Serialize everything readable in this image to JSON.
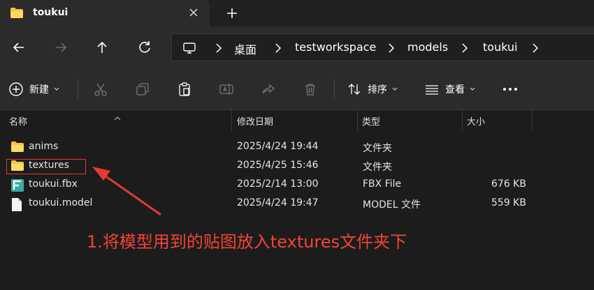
{
  "tab": {
    "title": "toukui",
    "icon": "folder-icon",
    "close_icon": "close-icon",
    "new_tab_icon": "plus-icon"
  },
  "nav": {
    "back_icon": "arrow-left-icon",
    "forward_icon": "arrow-right-icon",
    "up_icon": "arrow-up-icon",
    "refresh_icon": "refresh-icon"
  },
  "breadcrumb": {
    "root_icon": "computer-icon",
    "items": [
      "桌面",
      "testworkspace",
      "models",
      "toukui"
    ]
  },
  "toolbar": {
    "new_label": "新建",
    "sort_label": "排序",
    "view_label": "查看"
  },
  "columns": {
    "name": "名称",
    "modified": "修改日期",
    "type": "类型",
    "size": "大小"
  },
  "files": [
    {
      "name": "anims",
      "modified": "2025/4/24 19:44",
      "type": "文件夹",
      "size": "",
      "icon": "folder-icon"
    },
    {
      "name": "textures",
      "modified": "2025/4/25 15:46",
      "type": "文件夹",
      "size": "",
      "icon": "folder-icon"
    },
    {
      "name": "toukui.fbx",
      "modified": "2025/2/14 13:00",
      "type": "FBX File",
      "size": "676 KB",
      "icon": "fbx-file-icon"
    },
    {
      "name": "toukui.model",
      "modified": "2025/4/24 19:47",
      "type": "MODEL 文件",
      "size": "559 KB",
      "icon": "file-icon"
    }
  ],
  "annotation": {
    "text": "1.将模型用到的贴图放入textures文件夹下",
    "color": "#f44336"
  },
  "colors": {
    "folder": "#f4c542",
    "accent": "#e53935"
  }
}
